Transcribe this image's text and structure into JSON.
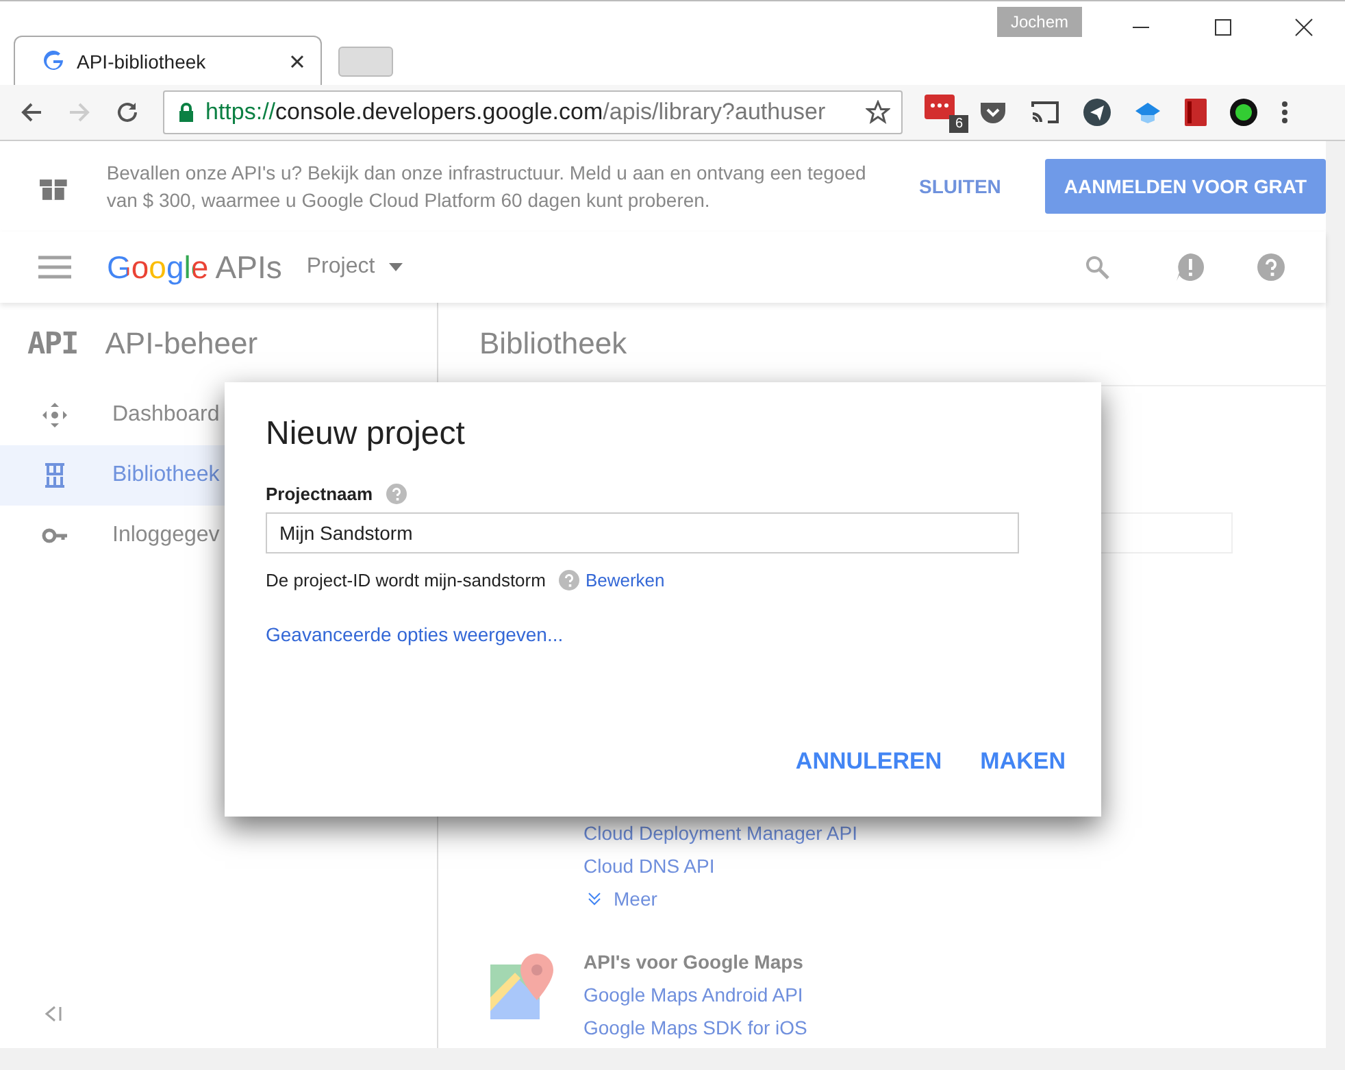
{
  "browser": {
    "tab_title": "API-bibliotheek",
    "profile": "Jochem",
    "url": {
      "scheme": "https://",
      "host": "console.developers.google.com",
      "path": "/apis/library?authuser"
    },
    "extension_badge": "6"
  },
  "banner": {
    "text": "Bevallen onze API's u? Bekijk dan onze infrastructuur. Meld u aan en ontvang een tegoed van $ 300, waarmee u Google Cloud Platform 60 dagen kunt proberen.",
    "close": "SLUITEN",
    "signup": "AANMELDEN VOOR GRAT"
  },
  "header": {
    "logo_google": "Google",
    "logo_apis": "APIs",
    "project": "Project"
  },
  "sidebar": {
    "badge": "API",
    "title": "API-beheer",
    "items": [
      {
        "label": "Dashboard",
        "selected": false
      },
      {
        "label": "Bibliotheek",
        "selected": true
      },
      {
        "label": "Inloggegev",
        "selected": false
      }
    ]
  },
  "main": {
    "title": "Bibliotheek",
    "groups": [
      {
        "links": [
          "Cloud Deployment Manager API",
          "Cloud DNS API"
        ],
        "more": "Meer"
      },
      {
        "title": "API's voor Google Maps",
        "links": [
          "Google Maps Android API",
          "Google Maps SDK for iOS"
        ]
      }
    ]
  },
  "dialog": {
    "title": "Nieuw project",
    "field_label": "Projectnaam",
    "field_value": "Mijn Sandstorm",
    "id_note": "De project-ID wordt mijn-sandstorm",
    "edit": "Bewerken",
    "advanced": "Geavanceerde opties weergeven...",
    "cancel": "ANNULEREN",
    "create": "MAKEN"
  }
}
